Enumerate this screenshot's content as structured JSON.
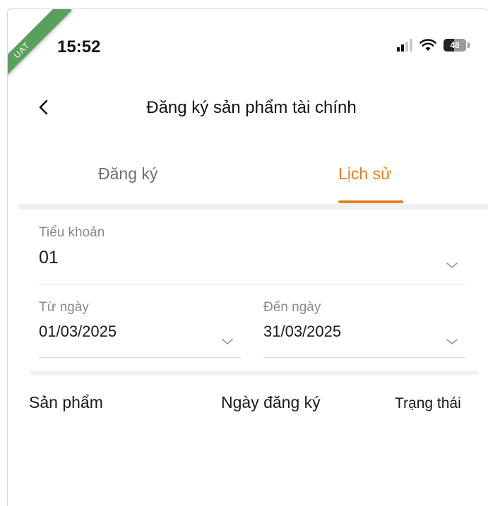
{
  "env_badge": "UAT",
  "status_bar": {
    "time": "15:52",
    "battery": "48"
  },
  "icons": {
    "back": "chevron-left-icon",
    "dropdown": "chevron-down-icon",
    "wifi": "wifi-icon",
    "signal": "signal-icon",
    "battery": "battery-icon"
  },
  "header": {
    "title": "Đăng ký sản phẩm tài chính"
  },
  "tabs": [
    {
      "label": "Đăng ký",
      "active": false
    },
    {
      "label": "Lịch sử",
      "active": true
    }
  ],
  "filters": {
    "sub_account": {
      "label": "Tiểu khoản",
      "value": "01"
    },
    "from_date": {
      "label": "Từ ngày",
      "value": "01/03/2025"
    },
    "to_date": {
      "label": "Đến ngày",
      "value": "31/03/2025"
    }
  },
  "table": {
    "columns": [
      "Sản phẩm",
      "Ngày đăng ký",
      "Trạng thái"
    ]
  },
  "colors": {
    "accent": "#e8801a",
    "badge": "#58a05c",
    "divider": "#eef0f4",
    "muted_text": "#8a8a8a"
  }
}
